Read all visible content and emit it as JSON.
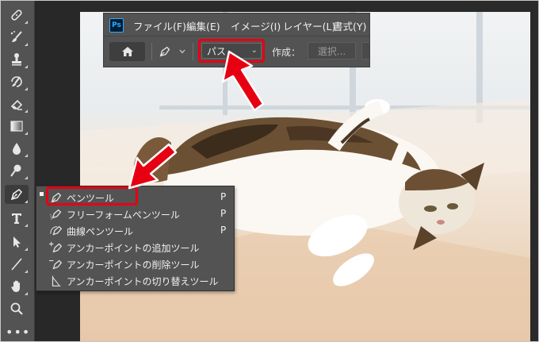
{
  "app": {
    "logo_text": "Ps"
  },
  "menubar": {
    "items": [
      "ファイル(F)",
      "編集(E)",
      "イメージ(I)",
      "レイヤー(L)",
      "書式(Y)"
    ]
  },
  "options_bar": {
    "mode_value": "パス",
    "make_label": "作成：",
    "select_button": "選択..."
  },
  "tools": [
    "healing-brush",
    "brush",
    "clone-stamp",
    "history-brush",
    "eraser",
    "gradient",
    "blur",
    "dodge",
    "pen",
    "type",
    "path-selection",
    "line",
    "hand",
    "zoom"
  ],
  "more_tools": "•••",
  "flyout": {
    "items": [
      {
        "label": "ペンツール",
        "key": "P",
        "selected": true
      },
      {
        "label": "フリーフォームペンツール",
        "key": "P",
        "selected": false
      },
      {
        "label": "曲線ペンツール",
        "key": "P",
        "selected": false
      },
      {
        "label": "アンカーポイントの追加ツール",
        "key": "",
        "selected": false
      },
      {
        "label": "アンカーポイントの削除ツール",
        "key": "",
        "selected": false
      },
      {
        "label": "アンカーポイントの切り替えツール",
        "key": "",
        "selected": false
      }
    ]
  },
  "colors": {
    "highlight": "#e60012",
    "panel": "#535353",
    "canvas": "#282828"
  }
}
